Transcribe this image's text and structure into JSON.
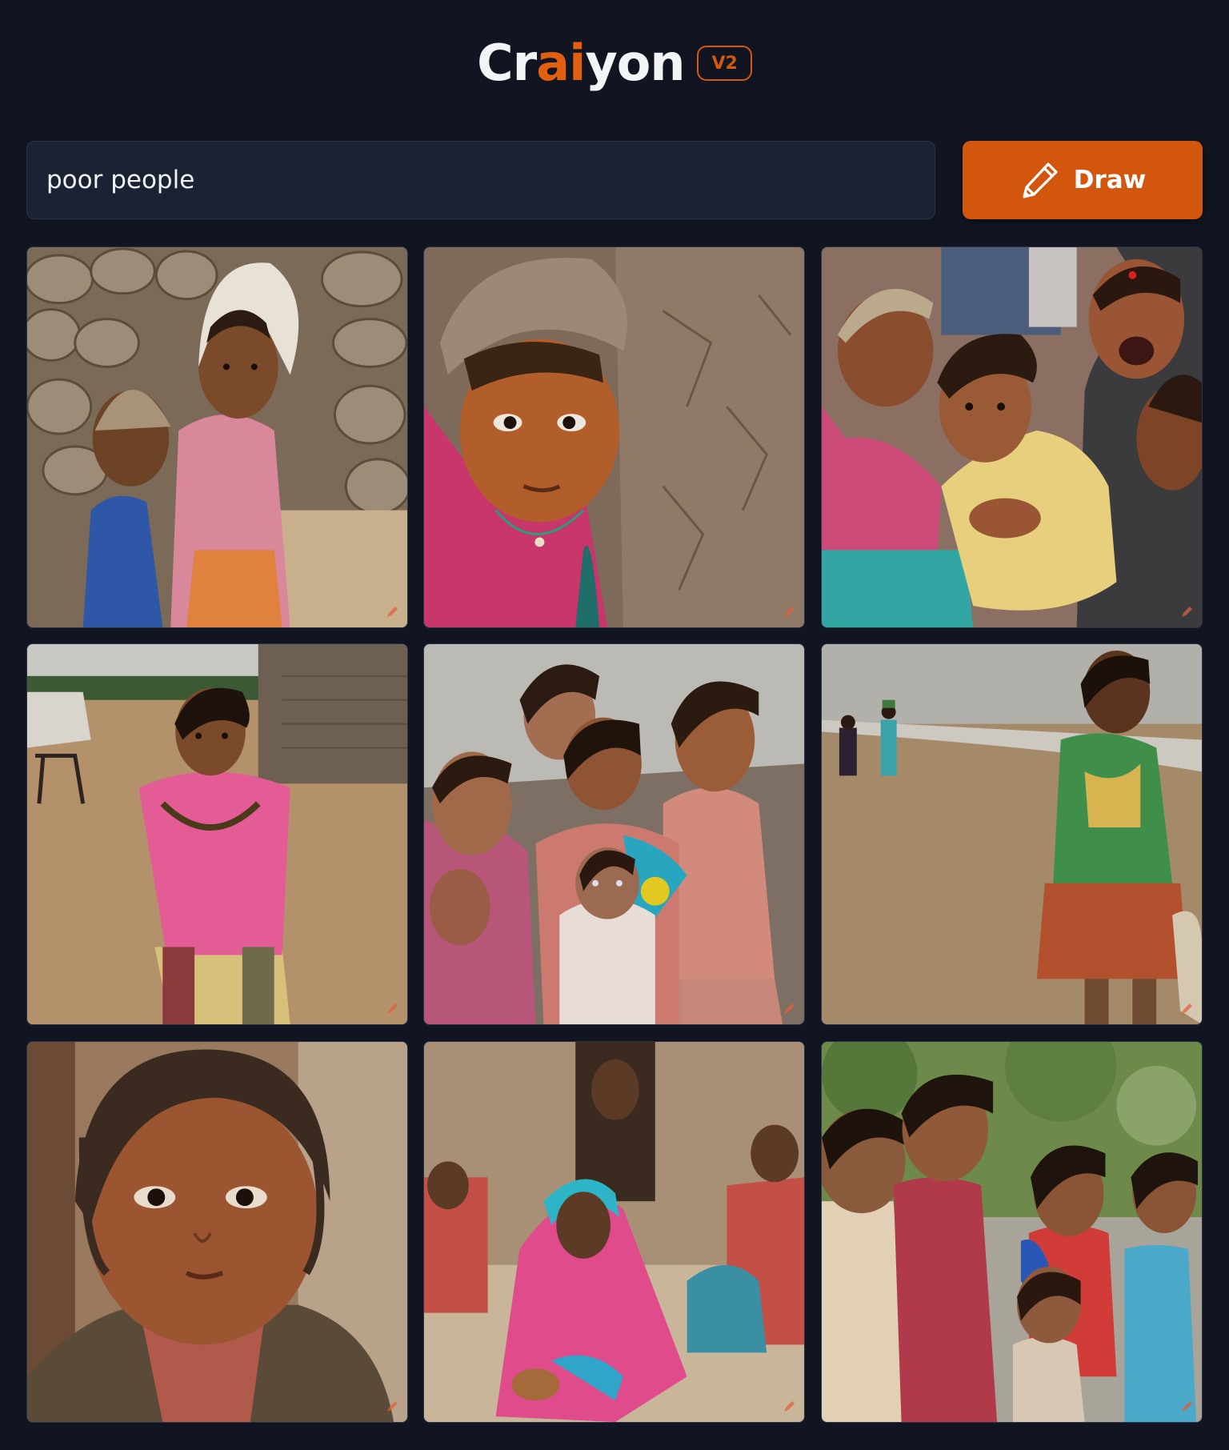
{
  "header": {
    "logo_pre": "Cr",
    "logo_accent": "ai",
    "logo_post": "yon",
    "version_label": "V2"
  },
  "search": {
    "value": "poor people",
    "draw_label": "Draw"
  },
  "colors": {
    "background": "#111521",
    "accent": "#d2560e",
    "input_background": "#1b2233"
  },
  "results": {
    "images": [
      {
        "name": "result-image-1"
      },
      {
        "name": "result-image-2"
      },
      {
        "name": "result-image-3"
      },
      {
        "name": "result-image-4"
      },
      {
        "name": "result-image-5"
      },
      {
        "name": "result-image-6"
      },
      {
        "name": "result-image-7"
      },
      {
        "name": "result-image-8"
      },
      {
        "name": "result-image-9"
      }
    ]
  }
}
